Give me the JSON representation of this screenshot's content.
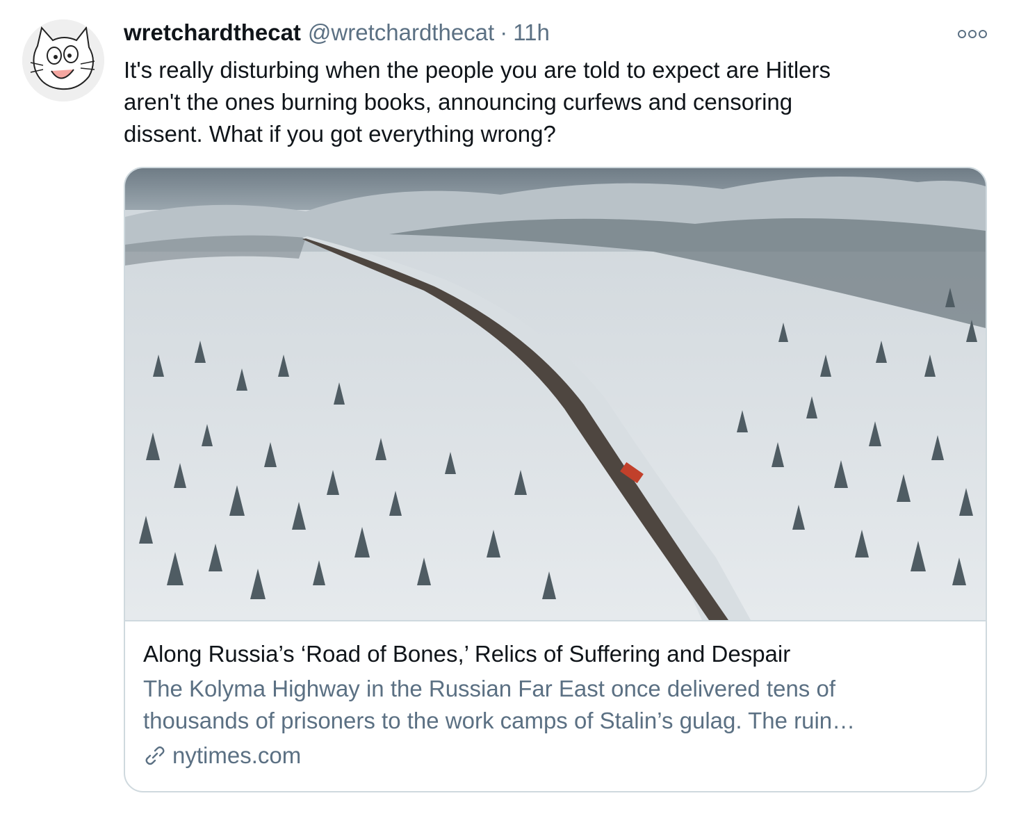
{
  "tweet": {
    "display_name": "wretchardthecat",
    "handle": "@wretchardthecat",
    "separator": "·",
    "time": "11h",
    "more_icon": "more-horizontal-icon",
    "text_lines": [
      "It's really disturbing when the people you are told to expect are Hitlers",
      "aren't the ones burning books, announcing curfews and censoring",
      "dissent. What if you got everything wrong?"
    ]
  },
  "card": {
    "title": "Along Russia’s ‘Road of Bones,’ Relics of Suffering and Despair",
    "description_lines": [
      "The Kolyma Highway in the Russian Far East once delivered tens of",
      "thousands of prisoners to the work camps of Stalin’s gulag. The ruin…"
    ],
    "domain": "nytimes.com",
    "domain_icon": "link-icon"
  },
  "colors": {
    "text_primary": "#0f1419",
    "text_secondary": "#5b7083",
    "border": "#cfd9de"
  }
}
